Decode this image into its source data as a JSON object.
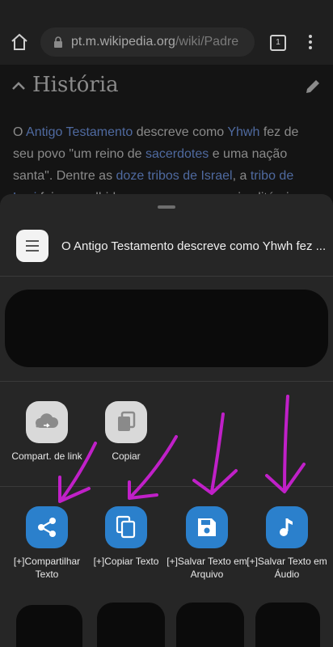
{
  "browser": {
    "url_host": "pt.m.wikipedia.org",
    "url_path": "/wiki/Padre",
    "tab_count": "1"
  },
  "page": {
    "section_title": "História",
    "paragraph": [
      {
        "t": "O "
      },
      {
        "t": "Antigo Testamento",
        "link": true
      },
      {
        "t": " descreve como "
      },
      {
        "t": "Yhwh",
        "link": true
      },
      {
        "t": " fez de seu povo \"um reino de "
      },
      {
        "t": "sacerdotes",
        "link": true
      },
      {
        "t": " e uma nação santa\". Dentre as "
      },
      {
        "t": "doze tribos de Israel",
        "link": true
      },
      {
        "t": ", a "
      },
      {
        "t": "tribo de Levi",
        "link": true
      },
      {
        "t": " foi a escolhida para exercer o serviço litúrgico de"
      }
    ]
  },
  "share_sheet": {
    "preview_text": "O Antigo Testamento descreve como Yhwh fez ...",
    "row1": [
      {
        "label": "Compart. de link",
        "icon": "cloud-link-icon"
      },
      {
        "label": "Copiar",
        "icon": "copy-icon"
      }
    ],
    "row2": [
      {
        "label": "[+]Compartilhar Texto",
        "icon": "share-icon"
      },
      {
        "label": "[+]Copiar Texto",
        "icon": "copy-icon"
      },
      {
        "label": "[+]Salvar Texto em Arquivo",
        "icon": "save-icon"
      },
      {
        "label": "[+]Salvar Texto em Áudio",
        "icon": "music-note-icon"
      }
    ]
  },
  "colors": {
    "accent_blue": "#2b80cc",
    "annotation_magenta": "#c020c8"
  }
}
